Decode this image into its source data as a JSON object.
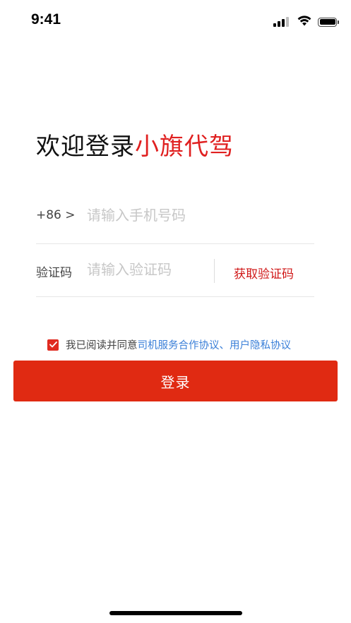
{
  "status_bar": {
    "time": "9:41",
    "icons": [
      "cellular-signal-icon",
      "wifi-icon",
      "battery-icon"
    ]
  },
  "header": {
    "welcome_prefix": "欢迎登录",
    "brand_name": "小旗代驾"
  },
  "phone": {
    "country_code": "+86 >",
    "placeholder": "请输入手机号码",
    "value": ""
  },
  "code": {
    "label": "验证码",
    "placeholder": "请输入验证码",
    "value": "",
    "get_code_label": "获取验证码"
  },
  "agreement": {
    "checked": true,
    "text": "我已阅读并同意",
    "link_driver": "司机服务合作协议",
    "separator": "、",
    "link_privacy": "用户隐私协议"
  },
  "login": {
    "label": "登录"
  },
  "colors": {
    "brand_red": "#e02020",
    "button_red": "#e02a12",
    "link_blue": "#3a7fd8",
    "placeholder_gray": "#c7c7c7"
  }
}
